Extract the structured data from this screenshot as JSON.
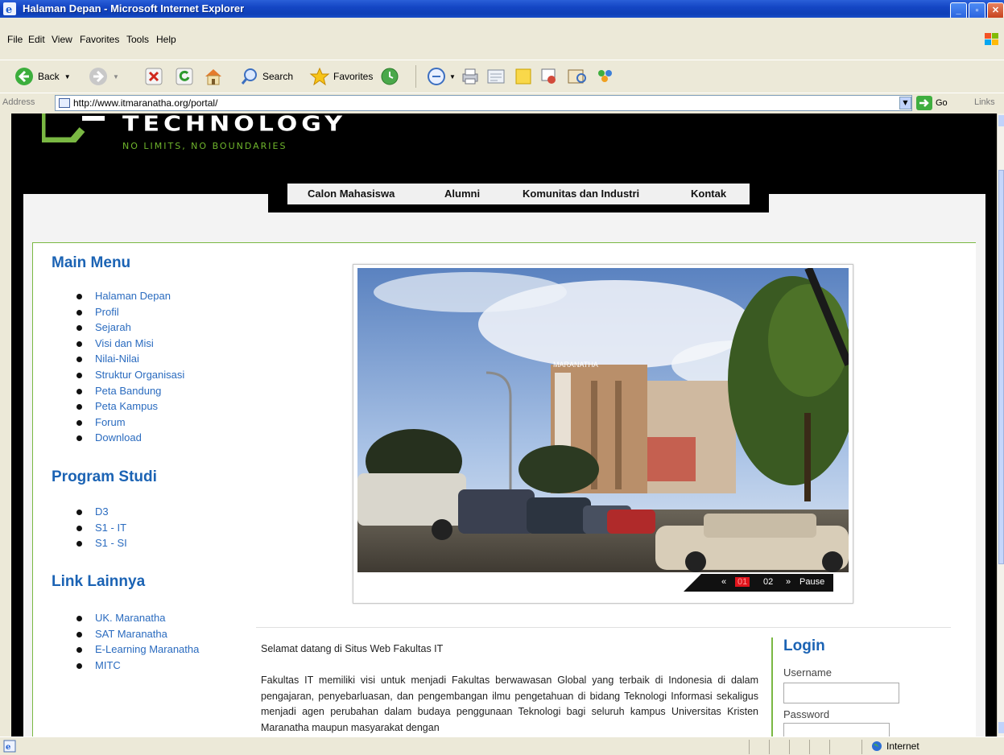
{
  "window": {
    "title": "Halaman Depan - Microsoft Internet Explorer"
  },
  "menubar": [
    "File",
    "Edit",
    "View",
    "Favorites",
    "Tools",
    "Help"
  ],
  "toolbar": {
    "back": "Back",
    "search": "Search",
    "favorites": "Favorites"
  },
  "addressbar": {
    "label": "Address",
    "url": "http://www.itmaranatha.org/portal/",
    "go": "Go",
    "links": "Links"
  },
  "site": {
    "logo_word": "TECHNOLOGY",
    "tagline": "NO LIMITS, NO BOUNDARIES",
    "nav": [
      "Calon Mahasiswa",
      "Alumni",
      "Komunitas dan Industri",
      "Kontak"
    ],
    "main_menu": {
      "title": "Main Menu",
      "items": [
        "Halaman Depan",
        "Profil",
        "Sejarah",
        "Visi dan Misi",
        "Nilai-Nilai",
        "Struktur Organisasi",
        "Peta Bandung",
        "Peta Kampus",
        "Forum",
        "Download"
      ]
    },
    "program_studi": {
      "title": "Program Studi",
      "items": [
        "D3",
        "S1 - IT",
        "S1 - SI"
      ]
    },
    "link_lainnya": {
      "title": "Link Lainnya",
      "items": [
        "UK. Maranatha",
        "SAT Maranatha",
        "E-Learning Maranatha",
        "MITC"
      ]
    },
    "slider": {
      "prev": "«",
      "page1": "01",
      "page2": "02",
      "next": "»",
      "pause": "Pause",
      "building_sign": "MARANATHA"
    },
    "welcome": "Selamat datang di Situs Web Fakultas IT",
    "intro": "Fakultas IT memiliki visi untuk menjadi Fakultas berwawasan Global yang terbaik di Indonesia di dalam pengajaran, penyebarluasan, dan pengembangan ilmu pengetahuan di bidang Teknologi Informasi sekaligus menjadi agen perubahan dalam budaya penggunaan Teknologi bagi seluruh kampus Universitas Kristen Maranatha maupun masyarakat dengan",
    "login": {
      "title": "Login",
      "username_label": "Username",
      "password_label": "Password"
    }
  },
  "statusbar": {
    "zone": "Internet"
  },
  "colors": {
    "accent_blue": "#1b63b4",
    "link_blue": "#2a6bbf",
    "brand_green": "#7ab843",
    "title_bar": "#0f3fb7"
  }
}
